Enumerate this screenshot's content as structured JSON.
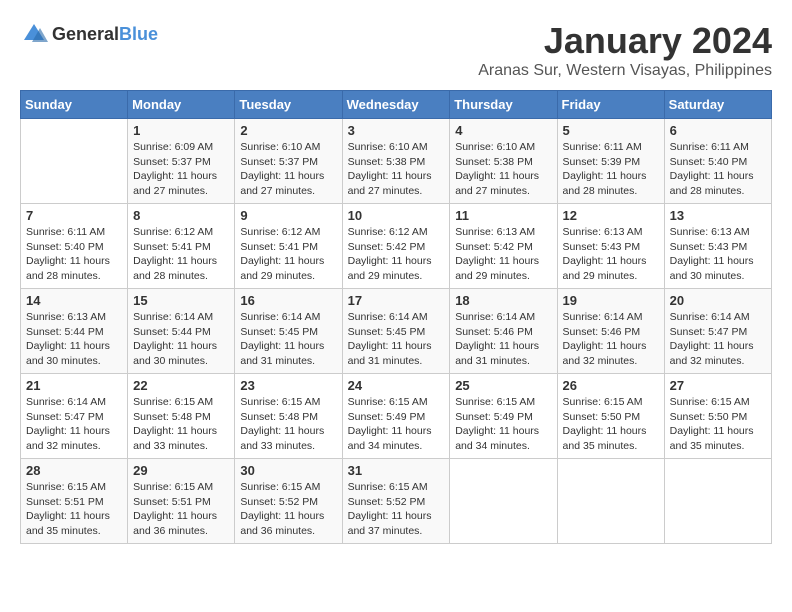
{
  "logo": {
    "general": "General",
    "blue": "Blue"
  },
  "title": "January 2024",
  "subtitle": "Aranas Sur, Western Visayas, Philippines",
  "days_of_week": [
    "Sunday",
    "Monday",
    "Tuesday",
    "Wednesday",
    "Thursday",
    "Friday",
    "Saturday"
  ],
  "weeks": [
    [
      {
        "day": "",
        "sunrise": "",
        "sunset": "",
        "daylight": ""
      },
      {
        "day": "1",
        "sunrise": "Sunrise: 6:09 AM",
        "sunset": "Sunset: 5:37 PM",
        "daylight": "Daylight: 11 hours and 27 minutes."
      },
      {
        "day": "2",
        "sunrise": "Sunrise: 6:10 AM",
        "sunset": "Sunset: 5:37 PM",
        "daylight": "Daylight: 11 hours and 27 minutes."
      },
      {
        "day": "3",
        "sunrise": "Sunrise: 6:10 AM",
        "sunset": "Sunset: 5:38 PM",
        "daylight": "Daylight: 11 hours and 27 minutes."
      },
      {
        "day": "4",
        "sunrise": "Sunrise: 6:10 AM",
        "sunset": "Sunset: 5:38 PM",
        "daylight": "Daylight: 11 hours and 27 minutes."
      },
      {
        "day": "5",
        "sunrise": "Sunrise: 6:11 AM",
        "sunset": "Sunset: 5:39 PM",
        "daylight": "Daylight: 11 hours and 28 minutes."
      },
      {
        "day": "6",
        "sunrise": "Sunrise: 6:11 AM",
        "sunset": "Sunset: 5:40 PM",
        "daylight": "Daylight: 11 hours and 28 minutes."
      }
    ],
    [
      {
        "day": "7",
        "sunrise": "Sunrise: 6:11 AM",
        "sunset": "Sunset: 5:40 PM",
        "daylight": "Daylight: 11 hours and 28 minutes."
      },
      {
        "day": "8",
        "sunrise": "Sunrise: 6:12 AM",
        "sunset": "Sunset: 5:41 PM",
        "daylight": "Daylight: 11 hours and 28 minutes."
      },
      {
        "day": "9",
        "sunrise": "Sunrise: 6:12 AM",
        "sunset": "Sunset: 5:41 PM",
        "daylight": "Daylight: 11 hours and 29 minutes."
      },
      {
        "day": "10",
        "sunrise": "Sunrise: 6:12 AM",
        "sunset": "Sunset: 5:42 PM",
        "daylight": "Daylight: 11 hours and 29 minutes."
      },
      {
        "day": "11",
        "sunrise": "Sunrise: 6:13 AM",
        "sunset": "Sunset: 5:42 PM",
        "daylight": "Daylight: 11 hours and 29 minutes."
      },
      {
        "day": "12",
        "sunrise": "Sunrise: 6:13 AM",
        "sunset": "Sunset: 5:43 PM",
        "daylight": "Daylight: 11 hours and 29 minutes."
      },
      {
        "day": "13",
        "sunrise": "Sunrise: 6:13 AM",
        "sunset": "Sunset: 5:43 PM",
        "daylight": "Daylight: 11 hours and 30 minutes."
      }
    ],
    [
      {
        "day": "14",
        "sunrise": "Sunrise: 6:13 AM",
        "sunset": "Sunset: 5:44 PM",
        "daylight": "Daylight: 11 hours and 30 minutes."
      },
      {
        "day": "15",
        "sunrise": "Sunrise: 6:14 AM",
        "sunset": "Sunset: 5:44 PM",
        "daylight": "Daylight: 11 hours and 30 minutes."
      },
      {
        "day": "16",
        "sunrise": "Sunrise: 6:14 AM",
        "sunset": "Sunset: 5:45 PM",
        "daylight": "Daylight: 11 hours and 31 minutes."
      },
      {
        "day": "17",
        "sunrise": "Sunrise: 6:14 AM",
        "sunset": "Sunset: 5:45 PM",
        "daylight": "Daylight: 11 hours and 31 minutes."
      },
      {
        "day": "18",
        "sunrise": "Sunrise: 6:14 AM",
        "sunset": "Sunset: 5:46 PM",
        "daylight": "Daylight: 11 hours and 31 minutes."
      },
      {
        "day": "19",
        "sunrise": "Sunrise: 6:14 AM",
        "sunset": "Sunset: 5:46 PM",
        "daylight": "Daylight: 11 hours and 32 minutes."
      },
      {
        "day": "20",
        "sunrise": "Sunrise: 6:14 AM",
        "sunset": "Sunset: 5:47 PM",
        "daylight": "Daylight: 11 hours and 32 minutes."
      }
    ],
    [
      {
        "day": "21",
        "sunrise": "Sunrise: 6:14 AM",
        "sunset": "Sunset: 5:47 PM",
        "daylight": "Daylight: 11 hours and 32 minutes."
      },
      {
        "day": "22",
        "sunrise": "Sunrise: 6:15 AM",
        "sunset": "Sunset: 5:48 PM",
        "daylight": "Daylight: 11 hours and 33 minutes."
      },
      {
        "day": "23",
        "sunrise": "Sunrise: 6:15 AM",
        "sunset": "Sunset: 5:48 PM",
        "daylight": "Daylight: 11 hours and 33 minutes."
      },
      {
        "day": "24",
        "sunrise": "Sunrise: 6:15 AM",
        "sunset": "Sunset: 5:49 PM",
        "daylight": "Daylight: 11 hours and 34 minutes."
      },
      {
        "day": "25",
        "sunrise": "Sunrise: 6:15 AM",
        "sunset": "Sunset: 5:49 PM",
        "daylight": "Daylight: 11 hours and 34 minutes."
      },
      {
        "day": "26",
        "sunrise": "Sunrise: 6:15 AM",
        "sunset": "Sunset: 5:50 PM",
        "daylight": "Daylight: 11 hours and 35 minutes."
      },
      {
        "day": "27",
        "sunrise": "Sunrise: 6:15 AM",
        "sunset": "Sunset: 5:50 PM",
        "daylight": "Daylight: 11 hours and 35 minutes."
      }
    ],
    [
      {
        "day": "28",
        "sunrise": "Sunrise: 6:15 AM",
        "sunset": "Sunset: 5:51 PM",
        "daylight": "Daylight: 11 hours and 35 minutes."
      },
      {
        "day": "29",
        "sunrise": "Sunrise: 6:15 AM",
        "sunset": "Sunset: 5:51 PM",
        "daylight": "Daylight: 11 hours and 36 minutes."
      },
      {
        "day": "30",
        "sunrise": "Sunrise: 6:15 AM",
        "sunset": "Sunset: 5:52 PM",
        "daylight": "Daylight: 11 hours and 36 minutes."
      },
      {
        "day": "31",
        "sunrise": "Sunrise: 6:15 AM",
        "sunset": "Sunset: 5:52 PM",
        "daylight": "Daylight: 11 hours and 37 minutes."
      },
      {
        "day": "",
        "sunrise": "",
        "sunset": "",
        "daylight": ""
      },
      {
        "day": "",
        "sunrise": "",
        "sunset": "",
        "daylight": ""
      },
      {
        "day": "",
        "sunrise": "",
        "sunset": "",
        "daylight": ""
      }
    ]
  ]
}
